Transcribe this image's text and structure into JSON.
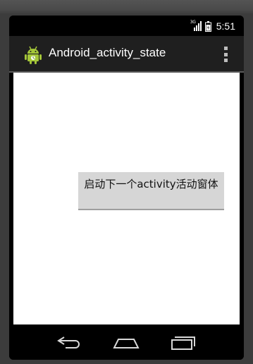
{
  "status_bar": {
    "network_label": "3G",
    "time": "5:51"
  },
  "action_bar": {
    "app_icon": "android-robot-icon",
    "title": "Android_activity_state",
    "overflow_icon": "overflow-menu-icon"
  },
  "main": {
    "launch_button_label": "启动下一个activity活动窗体"
  },
  "nav_bar": {
    "buttons": [
      "back-icon",
      "home-icon",
      "recent-apps-icon"
    ]
  },
  "colors": {
    "action_bar": "#1f1f1f",
    "content_background": "#ffffff",
    "button_background": "#d6d6d6",
    "app_icon_green": "#a4c639"
  }
}
